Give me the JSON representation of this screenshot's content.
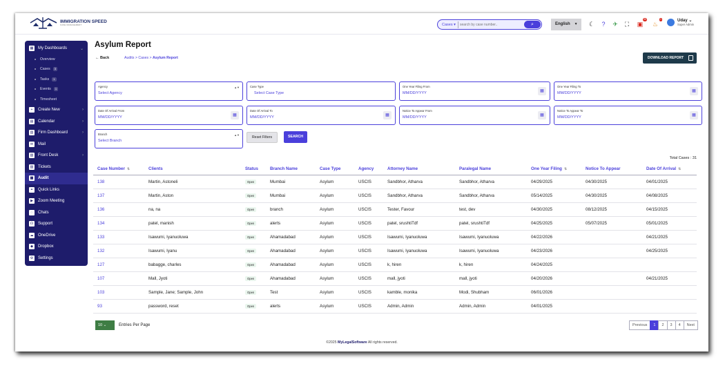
{
  "app": {
    "logo_text": "IMMIGRATION SPEED",
    "logo_sub": "CASE MANAGEMENT"
  },
  "topbar": {
    "search_category": "Cases",
    "search_placeholder": "search by case number..",
    "language": "English",
    "notif_badge_1": "99",
    "notif_badge_2": "1",
    "user_name": "Uday",
    "user_role": "Super Admin"
  },
  "sidebar": {
    "items": [
      {
        "label": "My Dashboards",
        "icon": "dashboard-icon"
      },
      {
        "label": "Overview",
        "sub": true
      },
      {
        "label": "Cases",
        "sub": true,
        "count": "3"
      },
      {
        "label": "Tasks",
        "sub": true,
        "count": "1"
      },
      {
        "label": "Events",
        "sub": true,
        "count": "1"
      },
      {
        "label": "Timesheet",
        "sub": true
      },
      {
        "label": "Create New",
        "icon": "plus-icon"
      },
      {
        "label": "Calendar",
        "icon": "calendar-icon"
      },
      {
        "label": "Firm Dashboard",
        "icon": "firm-icon"
      },
      {
        "label": "Mail",
        "icon": "mail-icon"
      },
      {
        "label": "Front Desk",
        "icon": "frontdesk-icon"
      },
      {
        "label": "Tickets",
        "icon": "ticket-icon"
      },
      {
        "label": "Audit",
        "icon": "audit-icon"
      },
      {
        "label": "Quick Links",
        "icon": "link-icon"
      },
      {
        "label": "Zoom Meeting",
        "icon": "video-icon"
      },
      {
        "label": "Chats",
        "icon": "chat-icon"
      },
      {
        "label": "Support",
        "icon": "support-icon"
      },
      {
        "label": "OneDrive",
        "icon": "cloud-icon"
      },
      {
        "label": "Dropbox",
        "icon": "dropbox-icon"
      },
      {
        "label": "Settings",
        "icon": "gear-icon"
      }
    ]
  },
  "page": {
    "title": "Asylum Report",
    "back": "Back",
    "crumb_1": "Audits",
    "crumb_2": "Cases",
    "crumb_3": "Asylum Report",
    "download": "DOWNLOAD REPORT"
  },
  "filters": {
    "agency_label": "Agency",
    "agency_value": "Select Agency",
    "casetype_label": "Case Type",
    "casetype_value": "Select Case Type",
    "oyf_from_label": "One Year Filing From",
    "oyf_to_label": "One Year Filing To",
    "arr_from_label": "Date Of Arrival From",
    "arr_to_label": "Date Of Arrival To",
    "nta_from_label": "Notice To Appear From",
    "nta_to_label": "Notice To Appear To",
    "date_placeholder": "MM/DD/YYYY",
    "branch_label": "Branch",
    "branch_value": "Select Branch",
    "reset": "Reset Filters",
    "search": "SEARCH"
  },
  "table": {
    "total": "Total Cases : 31",
    "headers": [
      "Case Number",
      "Clients",
      "Status",
      "Branch Name",
      "Case Type",
      "Agency",
      "Attorney Name",
      "Paralegal Name",
      "One Year Filing",
      "Notice To Appear",
      "Date Of Arrival"
    ],
    "rows": [
      [
        "138",
        "Martin, Astoneli",
        "Open",
        "Mumbai",
        "Asylum",
        "USCIS",
        "Sandbhor, Atharva",
        "Sandbhor, Atharva",
        "04/29/2025",
        "04/30/2025",
        "04/01/2025"
      ],
      [
        "137",
        "Martin, Aston",
        "Open",
        "Mumbai",
        "Asylum",
        "USCIS",
        "Sandbhor, Atharva",
        "Sandbhor, Atharva",
        "05/14/2025",
        "04/30/2025",
        "04/08/2025"
      ],
      [
        "136",
        "na, na",
        "Open",
        "branch",
        "Asylum",
        "USCIS",
        "Tester, Favour",
        "test, dev",
        "04/30/2025",
        "08/12/2025",
        "04/15/2025"
      ],
      [
        "134",
        "patel, manish",
        "Open",
        "alerts",
        "Asylum",
        "USCIS",
        "patel, srushtiTdf",
        "patel, srushtiTdf",
        "04/25/2025",
        "05/07/2025",
        "05/01/2025"
      ],
      [
        "133",
        "Isawumi, Iyanuoluwa",
        "Open",
        "Ahamadabad",
        "Asylum",
        "USCIS",
        "Isawumi, Iyanuoluwa",
        "Isawumi, Iyanuoluwa",
        "04/22/2026",
        "",
        "04/21/2025"
      ],
      [
        "132",
        "Isawumi, Iyanu",
        "Open",
        "Ahamadabad",
        "Asylum",
        "USCIS",
        "Isawumi, Iyanuoluwa",
        "Isawumi, Iyanuoluwa",
        "04/23/2026",
        "",
        "04/25/2025"
      ],
      [
        "127",
        "babagge, charles",
        "Open",
        "Ahamadabad",
        "Asylum",
        "USCIS",
        "k, hiren",
        "k, hiren",
        "04/24/2025",
        "",
        ""
      ],
      [
        "107",
        "Mall, Jyoti",
        "Open",
        "Ahamadabad",
        "Asylum",
        "USCIS",
        "mall, jyoti",
        "mall, jyoti",
        "04/20/2026",
        "",
        "04/21/2025"
      ],
      [
        "103",
        "Sample, Jane; Sample, John",
        "Open",
        "Test",
        "Asylum",
        "USCIS",
        "kamble, monika",
        "Modi, Shubham",
        "06/01/2026",
        "",
        ""
      ],
      [
        "93",
        "password, reset",
        "Open",
        "alerts",
        "Asylum",
        "USCIS",
        "Admin, Admin",
        "Admin, Admin",
        "04/01/2025",
        "",
        ""
      ]
    ]
  },
  "pagination": {
    "per_page_value": "10",
    "per_page_label": "Entries Per Page",
    "previous": "Previous",
    "pages": [
      "1",
      "2",
      "3",
      "4"
    ],
    "next": "Next"
  },
  "footer": {
    "prefix": "©2025",
    "brand": "MyLegalSoftware",
    "suffix": "All rights reserved."
  }
}
